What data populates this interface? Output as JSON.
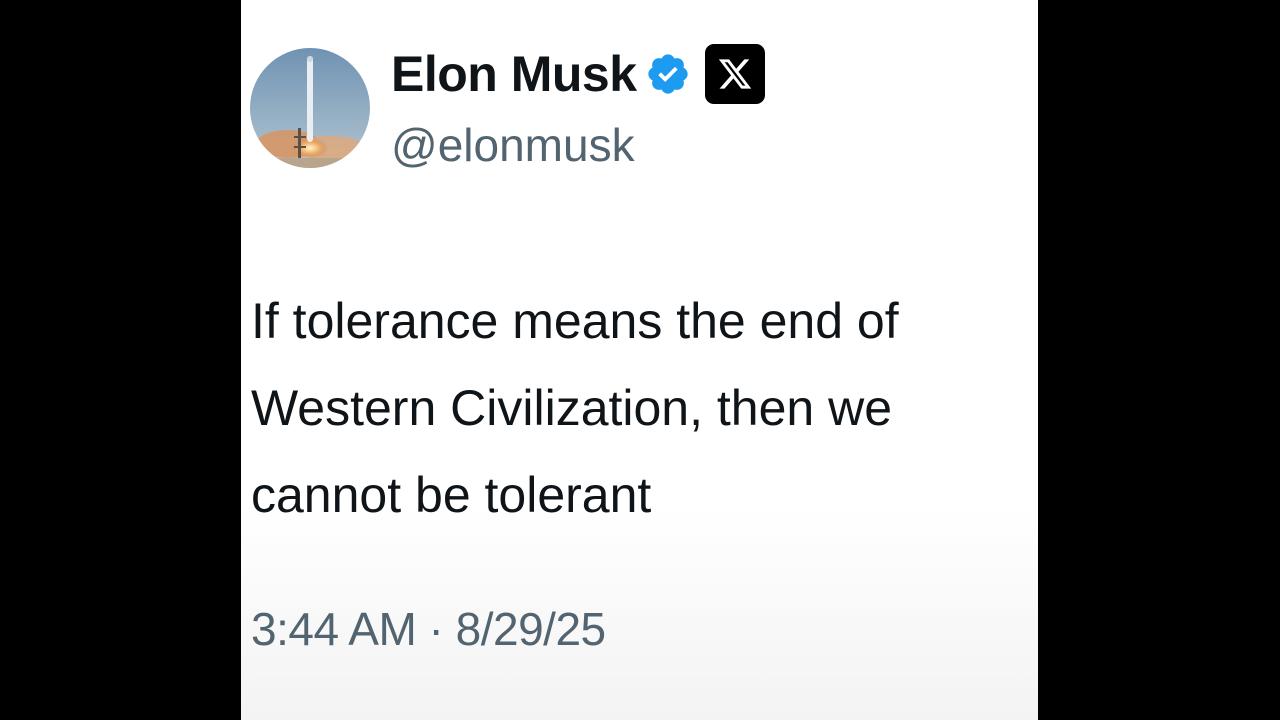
{
  "author": {
    "display_name": "Elon Musk",
    "handle": "@elonmusk",
    "avatar_icon": "rocket-launch-avatar",
    "verified_icon": "verified-badge-icon",
    "platform_icon": "x-logo-icon"
  },
  "tweet": {
    "lines": [
      "If tolerance means the end of",
      "Western Civilization, then we",
      "cannot be tolerant"
    ],
    "timestamp": "3:44 AM · 8/29/25"
  },
  "colors": {
    "background": "#000000",
    "card": "#ffffff",
    "text": "#0f1419",
    "secondary_text": "#536471",
    "verified_blue": "#1d9bf0"
  }
}
